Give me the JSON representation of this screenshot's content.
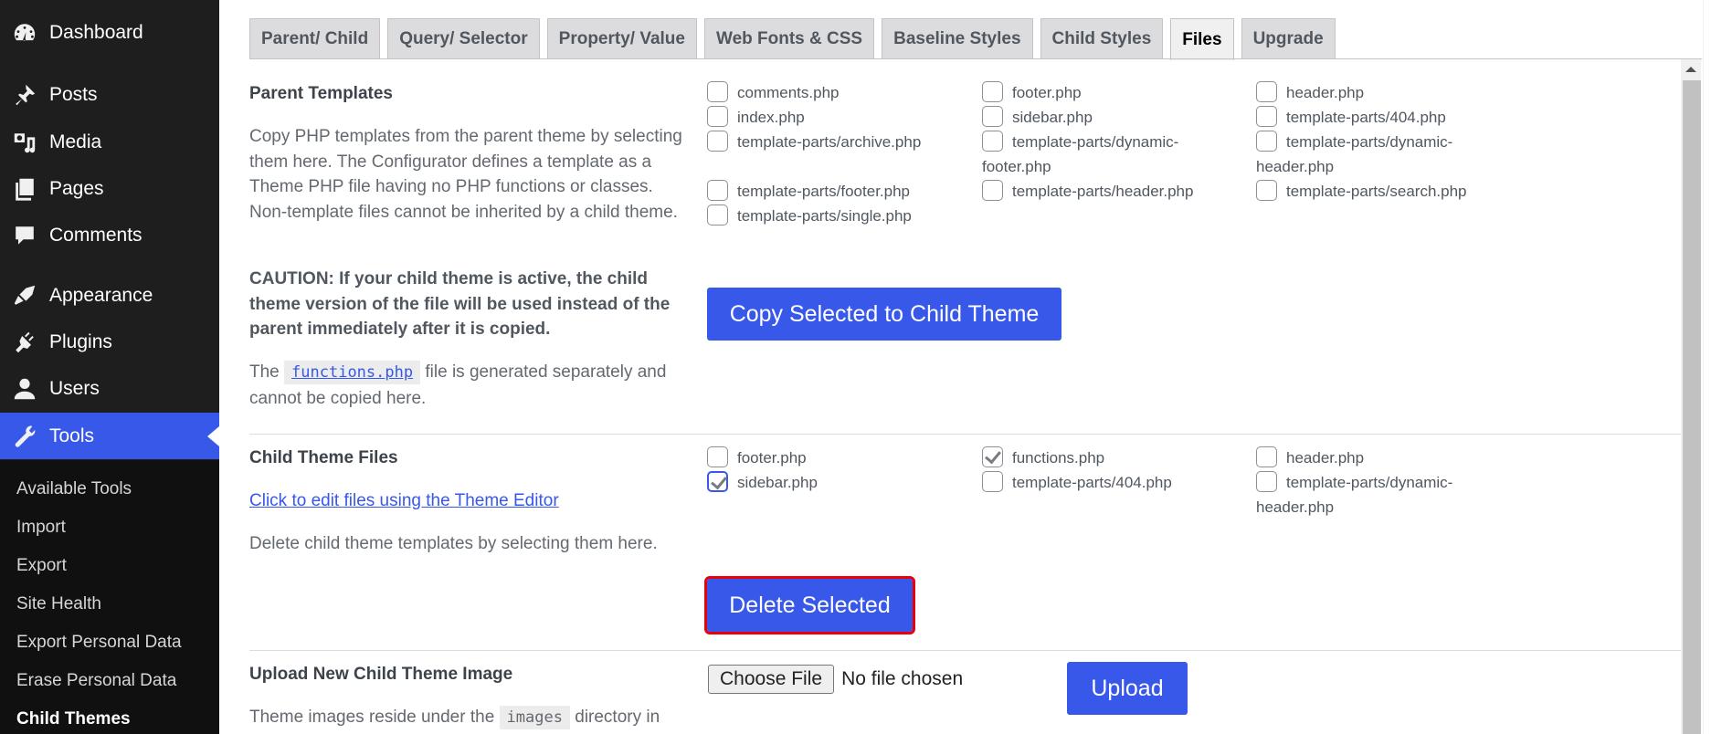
{
  "sidebar": {
    "items": [
      {
        "label": "Dashboard",
        "icon": "dashboard-icon"
      },
      {
        "label": "Posts",
        "icon": "pushpin-icon"
      },
      {
        "label": "Media",
        "icon": "media-icon"
      },
      {
        "label": "Pages",
        "icon": "pages-icon"
      },
      {
        "label": "Comments",
        "icon": "comment-icon"
      },
      {
        "label": "Appearance",
        "icon": "paintbrush-icon"
      },
      {
        "label": "Plugins",
        "icon": "plugin-icon"
      },
      {
        "label": "Users",
        "icon": "user-icon"
      },
      {
        "label": "Tools",
        "icon": "wrench-icon",
        "active": true
      }
    ],
    "submenu": [
      "Available Tools",
      "Import",
      "Export",
      "Site Health",
      "Export Personal Data",
      "Erase Personal Data",
      "Child Themes"
    ],
    "current_submenu": "Child Themes"
  },
  "tabs": [
    {
      "label": "Parent/ Child"
    },
    {
      "label": "Query/ Selector"
    },
    {
      "label": "Property/ Value"
    },
    {
      "label": "Web Fonts & CSS"
    },
    {
      "label": "Baseline Styles"
    },
    {
      "label": "Child Styles"
    },
    {
      "label": "Files",
      "active": true
    },
    {
      "label": "Upgrade"
    }
  ],
  "parent_templates": {
    "title": "Parent Templates",
    "description": "Copy PHP templates from the parent theme by selecting them here. The Configurator defines a template as a Theme PHP file having no PHP functions or classes. Non-template files cannot be inherited by a child theme.",
    "caution": "CAUTION: If your child theme is active, the child theme version of the file will be used instead of the parent immediately after it is copied.",
    "note_prefix": "The",
    "note_code": "functions.php",
    "note_suffix": "file is generated separately and cannot be copied here.",
    "files_col1": [
      {
        "name": "comments.php",
        "checked": false
      },
      {
        "name": "index.php",
        "checked": false
      },
      {
        "name": "template-parts/archive.php",
        "checked": false
      },
      {
        "name": "template-parts/footer.php",
        "checked": false
      },
      {
        "name": "template-parts/single.php",
        "checked": false
      }
    ],
    "files_col2": [
      {
        "name": "footer.php",
        "checked": false
      },
      {
        "name": "sidebar.php",
        "checked": false
      },
      {
        "name": "template-parts/dynamic-footer.php",
        "checked": false
      },
      {
        "name": "template-parts/header.php",
        "checked": false
      }
    ],
    "files_col3": [
      {
        "name": "header.php",
        "checked": false
      },
      {
        "name": "template-parts/404.php",
        "checked": false
      },
      {
        "name": "template-parts/dynamic-header.php",
        "checked": false
      },
      {
        "name": "template-parts/search.php",
        "checked": false
      }
    ],
    "copy_button": "Copy Selected to Child Theme"
  },
  "child_files": {
    "title": "Child Theme Files",
    "editor_link": "Click to edit files using the Theme Editor",
    "description": "Delete child theme templates by selecting them here.",
    "files_col1": [
      {
        "name": "footer.php",
        "checked": false
      },
      {
        "name": "sidebar.php",
        "checked": true,
        "focused": true
      }
    ],
    "files_col2": [
      {
        "name": "functions.php",
        "checked": true
      },
      {
        "name": "template-parts/404.php",
        "checked": false
      }
    ],
    "files_col3": [
      {
        "name": "header.php",
        "checked": false
      },
      {
        "name": "template-parts/dynamic-header.php",
        "checked": false
      }
    ],
    "delete_button": "Delete Selected"
  },
  "upload_image": {
    "title": "Upload New Child Theme Image",
    "description_prefix": "Theme images reside under the",
    "description_code": "images",
    "description_suffix": "directory in",
    "choose_file_label": "Choose File",
    "no_file_text": "No file chosen",
    "upload_button": "Upload"
  },
  "colors": {
    "accent": "#3858e9",
    "sidebar_bg": "#1e1e1e",
    "highlight_outline": "#e8000b"
  }
}
